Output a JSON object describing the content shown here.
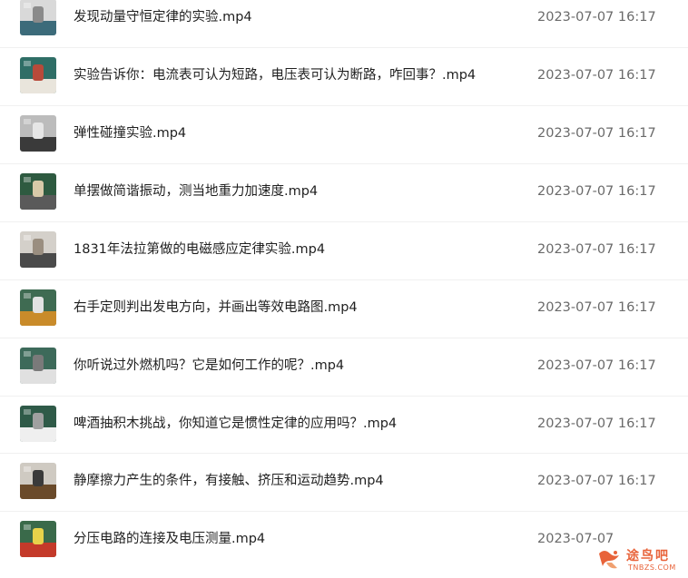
{
  "files": [
    {
      "name": "发现动量守恒定律的实验.mp4",
      "date": "2023-07-07 16:17",
      "thumb": [
        "#d9d9d9",
        "#3c6b7a",
        "#8a8a8a"
      ]
    },
    {
      "name": "实验告诉你：电流表可认为短路，电压表可认为断路，咋回事？.mp4",
      "date": "2023-07-07 16:17",
      "thumb": [
        "#2f6e66",
        "#e9e5dc",
        "#b84a3a"
      ]
    },
    {
      "name": "弹性碰撞实验.mp4",
      "date": "2023-07-07 16:17",
      "thumb": [
        "#bcbcbc",
        "#3a3a3a",
        "#e6e6e6"
      ]
    },
    {
      "name": "单摆做简谐振动，测当地重力加速度.mp4",
      "date": "2023-07-07 16:17",
      "thumb": [
        "#2e5a40",
        "#5a5a5a",
        "#d8c9a8"
      ]
    },
    {
      "name": "1831年法拉第做的电磁感应定律实验.mp4",
      "date": "2023-07-07 16:17",
      "thumb": [
        "#d4d0ca",
        "#4a4a4a",
        "#9a8e80"
      ]
    },
    {
      "name": "右手定则判出发电方向，并画出等效电路图.mp4",
      "date": "2023-07-07 16:17",
      "thumb": [
        "#3f6b52",
        "#c98b2a",
        "#e2e2e2"
      ]
    },
    {
      "name": "你听说过外燃机吗？它是如何工作的呢？.mp4",
      "date": "2023-07-07 16:17",
      "thumb": [
        "#3d6a5a",
        "#e0e0e0",
        "#7a7a7a"
      ]
    },
    {
      "name": "啤酒抽积木挑战，你知道它是惯性定律的应用吗？.mp4",
      "date": "2023-07-07 16:17",
      "thumb": [
        "#2f5a48",
        "#efefef",
        "#a0a0a0"
      ]
    },
    {
      "name": "静摩擦力产生的条件，有接触、挤压和运动趋势.mp4",
      "date": "2023-07-07 16:17",
      "thumb": [
        "#cfcac2",
        "#6a4a2a",
        "#3a3a3a"
      ]
    },
    {
      "name": "分压电路的连接及电压测量.mp4",
      "date": "2023-07-07",
      "thumb": [
        "#3a6a4a",
        "#c43a2a",
        "#e8d24a"
      ]
    }
  ],
  "watermark": {
    "text": "途鸟吧",
    "sub": "TNBZS.COM",
    "color": "#e8633a"
  }
}
